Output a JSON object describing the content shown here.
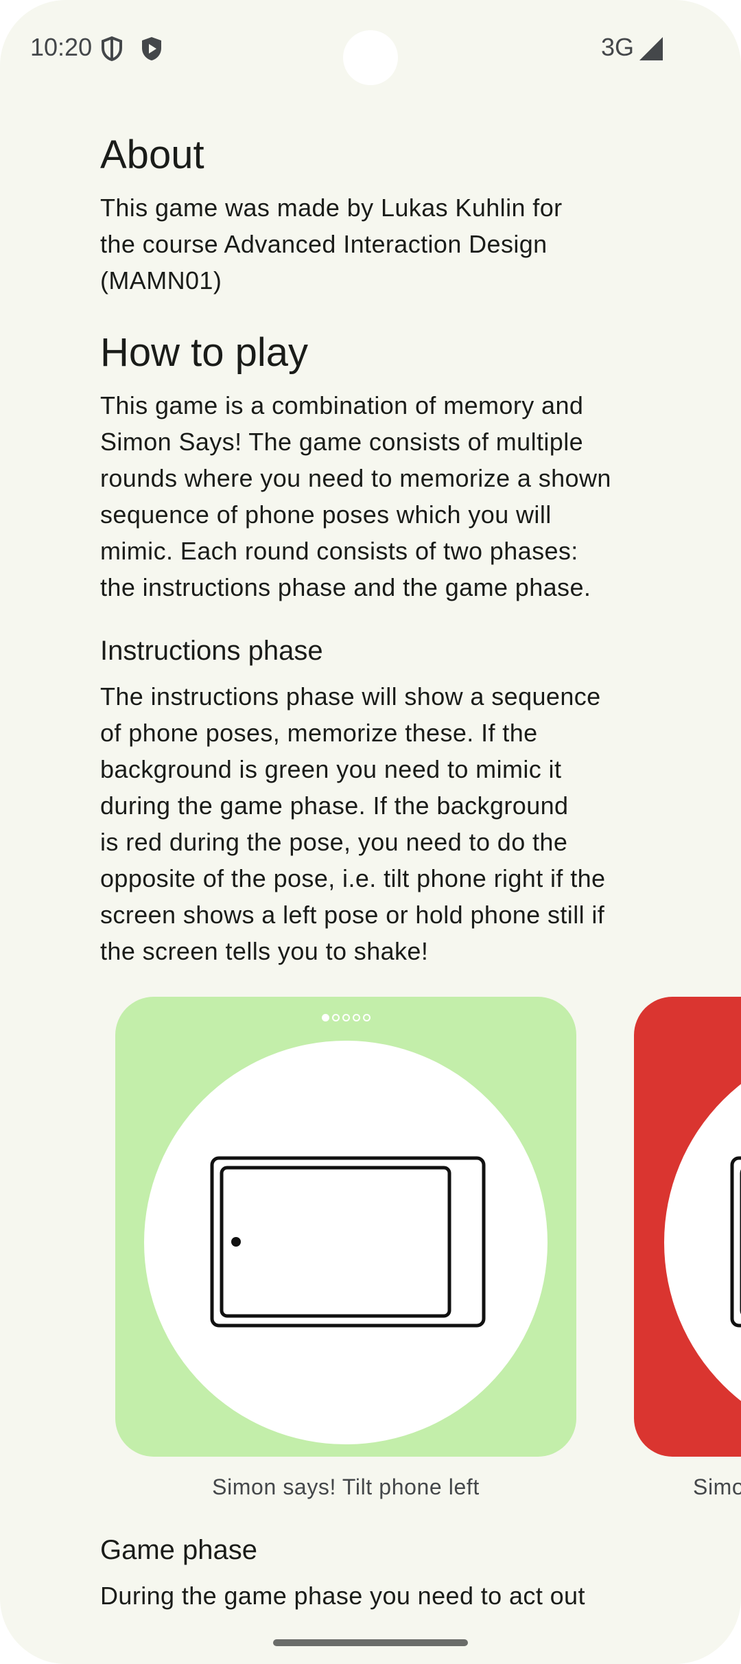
{
  "status_bar": {
    "time": "10:20",
    "network": "3G",
    "icons": [
      "shield-outline-icon",
      "shield-play-icon",
      "signal-icon"
    ]
  },
  "about": {
    "title": "About",
    "body_lines": [
      "This game was made by Lukas Kuhlin for",
      "the course Advanced Interaction Design",
      "(MAMN01)"
    ]
  },
  "how_to_play": {
    "title": "How to play",
    "body_lines": [
      "This game is a combination of memory and",
      "Simon Says! The game consists of multiple",
      "rounds where you need to memorize a shown",
      "sequence of phone poses which you will",
      "mimic. Each round consists of two phases:",
      "the instructions phase and the game phase."
    ]
  },
  "instructions_phase": {
    "title": "Instructions phase",
    "body_lines": [
      "The instructions phase will show a sequence",
      "of phone poses, memorize these. If the",
      "background is green you need to mimic it",
      "during the game phase. If the background",
      "is red during the pose, you need to do the",
      "opposite of the pose, i.e. tilt phone right if the",
      "screen shows a left pose or hold phone still if",
      "the screen tells you to shake!"
    ]
  },
  "carousel": {
    "page_count": 5,
    "active_page": 1,
    "slides": [
      {
        "caption": "Simon says! Tilt phone left",
        "background": "#c3eeaa",
        "pose_icon": "phone-tilt-left-icon"
      },
      {
        "caption": "Simo",
        "background": "#da3530",
        "pose_icon": "phone-pose-icon"
      }
    ]
  },
  "game_phase": {
    "title": "Game phase",
    "body_lines": [
      "During the game phase you need to act out"
    ]
  },
  "colors": {
    "background": "#f6f7ef",
    "text": "#1a1c19",
    "green_card": "#c3eeaa",
    "red_card": "#da3530"
  }
}
